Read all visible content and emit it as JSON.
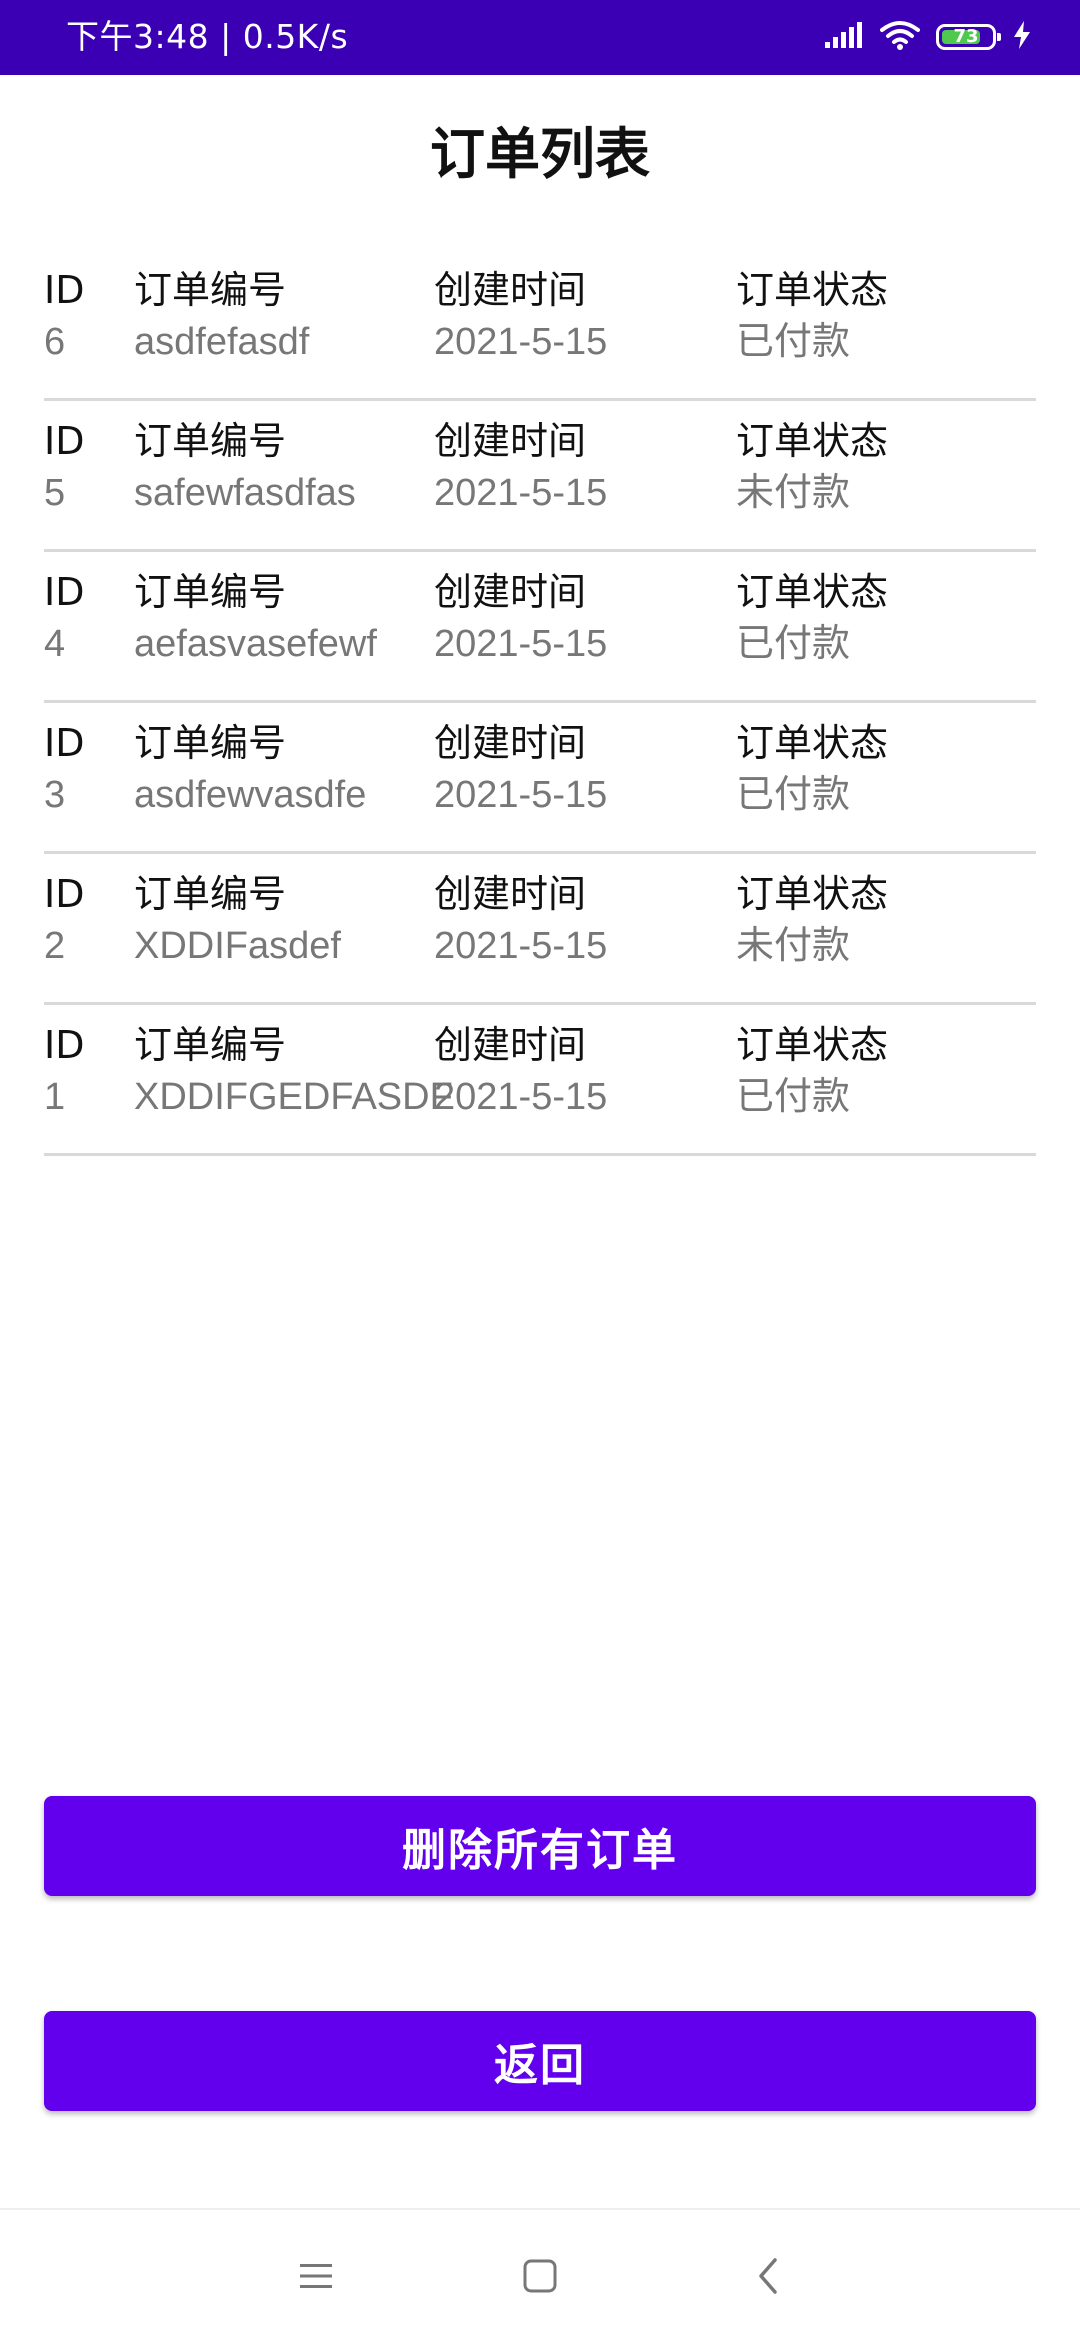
{
  "status_bar": {
    "time_speed": "下午3:48 | 0.5K/s",
    "battery_level": "73",
    "background_color": "#3b00b3",
    "icons": [
      "signal-icon",
      "wifi-icon",
      "battery-icon",
      "charging-icon"
    ]
  },
  "page": {
    "title": "订单列表"
  },
  "column_labels": {
    "id": "ID",
    "order_no": "订单编号",
    "created_time": "创建时间",
    "status": "订单状态"
  },
  "orders": [
    {
      "id": "6",
      "order_no": "asdfefasdf",
      "created_time": "2021-5-15",
      "status": "已付款"
    },
    {
      "id": "5",
      "order_no": "safewfasdfas",
      "created_time": "2021-5-15",
      "status": "未付款"
    },
    {
      "id": "4",
      "order_no": "aefasvasefewf",
      "created_time": "2021-5-15",
      "status": "已付款"
    },
    {
      "id": "3",
      "order_no": "asdfewvasdfe",
      "created_time": "2021-5-15",
      "status": "已付款"
    },
    {
      "id": "2",
      "order_no": "XDDIFasdef",
      "created_time": "2021-5-15",
      "status": "未付款"
    },
    {
      "id": "1",
      "order_no": "XDDIFGEDFASDF",
      "created_time": "2021-5-15",
      "status": "已付款"
    }
  ],
  "buttons": {
    "delete_all": "删除所有订单",
    "back": "返回",
    "accent_color": "#6200ee"
  },
  "nav_bar": {
    "icons": [
      "menu-icon",
      "home-icon",
      "back-icon"
    ]
  }
}
